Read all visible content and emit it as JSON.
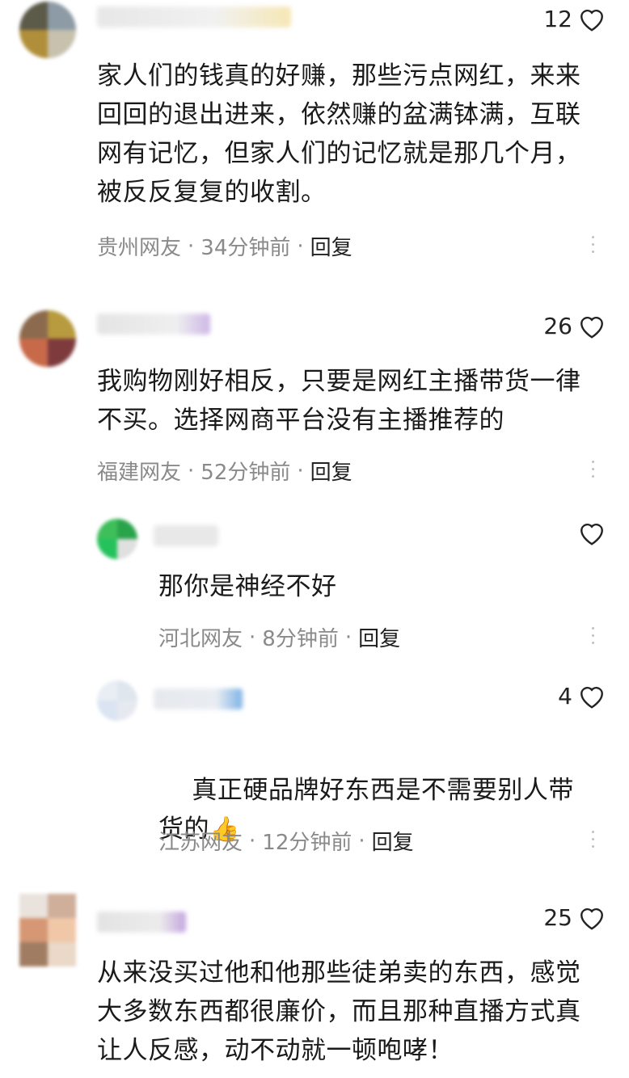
{
  "comments": [
    {
      "likes": "12",
      "text": "家人们的钱真的好赚，那些污点网红，来来回回的退出进来，依然赚的盆满钵满，互联网有记忆，但家人们的记忆就是那几个月，被反反复复的收割。",
      "location": "贵州网友",
      "time": "34分钟前",
      "reply": "回复"
    },
    {
      "likes": "26",
      "text": "我购物刚好相反，只要是网红主播带货一律不买。选择网商平台没有主播推荐的",
      "location": "福建网友",
      "time": "52分钟前",
      "reply": "回复"
    },
    {
      "likes": "",
      "text": "那你是神经不好",
      "location": "河北网友",
      "time": "8分钟前",
      "reply": "回复"
    },
    {
      "likes": "4",
      "text": "真正硬品牌好东西是不需要别人带货的",
      "emoji": "👍",
      "location": "江苏网友",
      "time": "12分钟前",
      "reply": "回复"
    },
    {
      "likes": "25",
      "text": "从来没买过他和他那些徒弟卖的东西，感觉大多数东西都很廉价，而且那种直播方式真让人反感，动不动就一顿咆哮！",
      "location": "",
      "time": "",
      "reply": ""
    }
  ],
  "separator": "·",
  "icons": {
    "like": "heart-outline-icon",
    "more": "vertical-dots-icon"
  }
}
